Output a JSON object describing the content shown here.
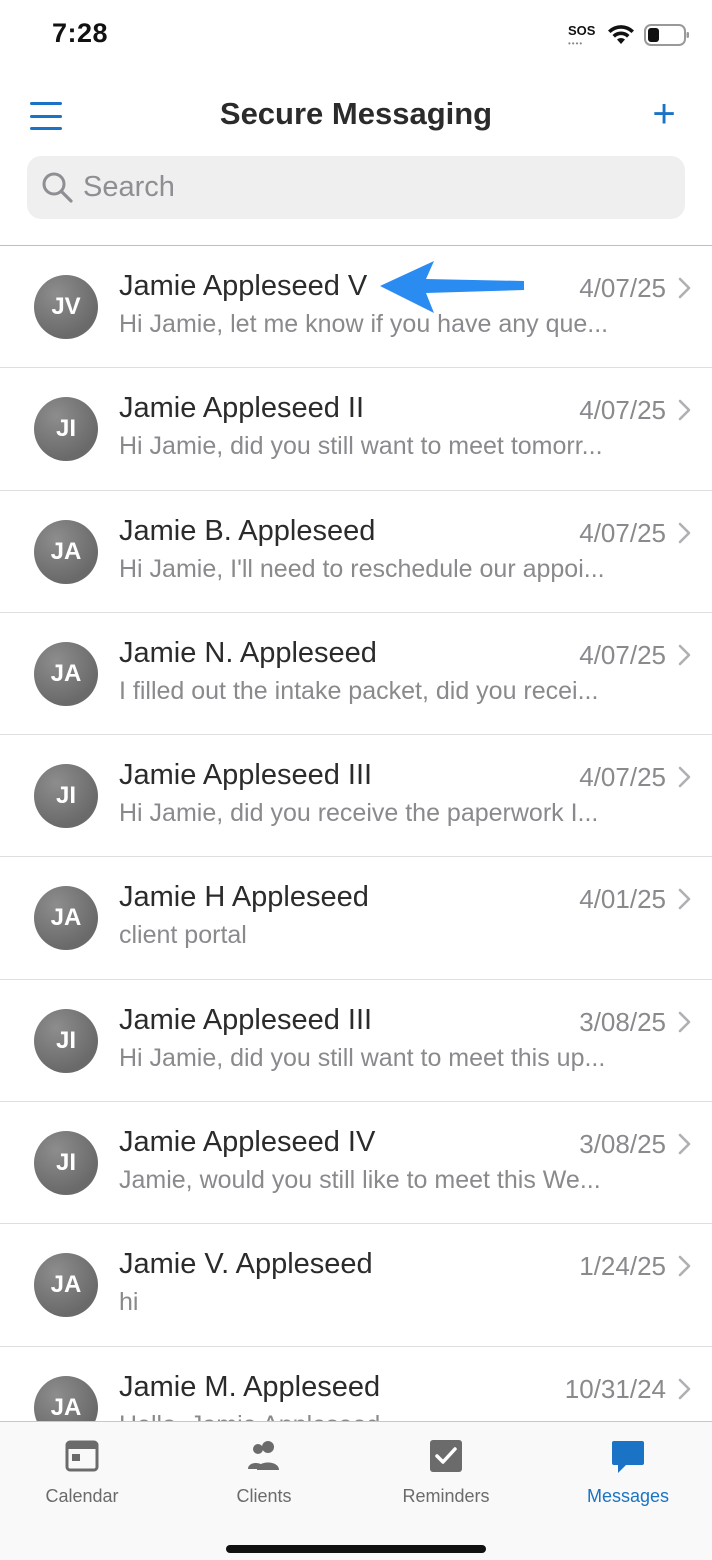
{
  "status_bar": {
    "time": "7:28",
    "sos": "SOS"
  },
  "nav": {
    "title": "Secure Messaging",
    "add_label": "+"
  },
  "search": {
    "placeholder": "Search",
    "value": ""
  },
  "conversations": [
    {
      "initials": "JV",
      "name": "Jamie Appleseed V",
      "date": "4/07/25",
      "preview": "Hi Jamie, let me know if you have any que..."
    },
    {
      "initials": "JI",
      "name": "Jamie Appleseed II",
      "date": "4/07/25",
      "preview": "Hi Jamie, did you still want to meet tomorr..."
    },
    {
      "initials": "JA",
      "name": "Jamie B. Appleseed",
      "date": "4/07/25",
      "preview": "Hi Jamie, I'll need to reschedule our appoi..."
    },
    {
      "initials": "JA",
      "name": "Jamie N. Appleseed",
      "date": "4/07/25",
      "preview": "I filled out the intake packet, did you recei..."
    },
    {
      "initials": "JI",
      "name": "Jamie Appleseed III",
      "date": "4/07/25",
      "preview": "Hi Jamie, did you receive the paperwork I..."
    },
    {
      "initials": "JA",
      "name": "Jamie H Appleseed",
      "date": "4/01/25",
      "preview": "client portal"
    },
    {
      "initials": "JI",
      "name": "Jamie Appleseed III",
      "date": "3/08/25",
      "preview": "Hi Jamie, did you still want to meet this up..."
    },
    {
      "initials": "JI",
      "name": "Jamie Appleseed IV",
      "date": "3/08/25",
      "preview": "Jamie, would you still like to meet this We..."
    },
    {
      "initials": "JA",
      "name": "Jamie V. Appleseed",
      "date": "1/24/25",
      "preview": "hi"
    },
    {
      "initials": "JA",
      "name": "Jamie M. Appleseed",
      "date": "10/31/24",
      "preview": "Hello, Jamie Appleseed"
    }
  ],
  "tabs": [
    {
      "label": "Calendar",
      "icon": "calendar-icon",
      "active": false
    },
    {
      "label": "Clients",
      "icon": "clients-icon",
      "active": false
    },
    {
      "label": "Reminders",
      "icon": "reminders-icon",
      "active": false
    },
    {
      "label": "Messages",
      "icon": "messages-icon",
      "active": true
    }
  ],
  "colors": {
    "accent": "#1a73c5",
    "arrow": "#2a8cf0",
    "avatar": "#777777"
  }
}
